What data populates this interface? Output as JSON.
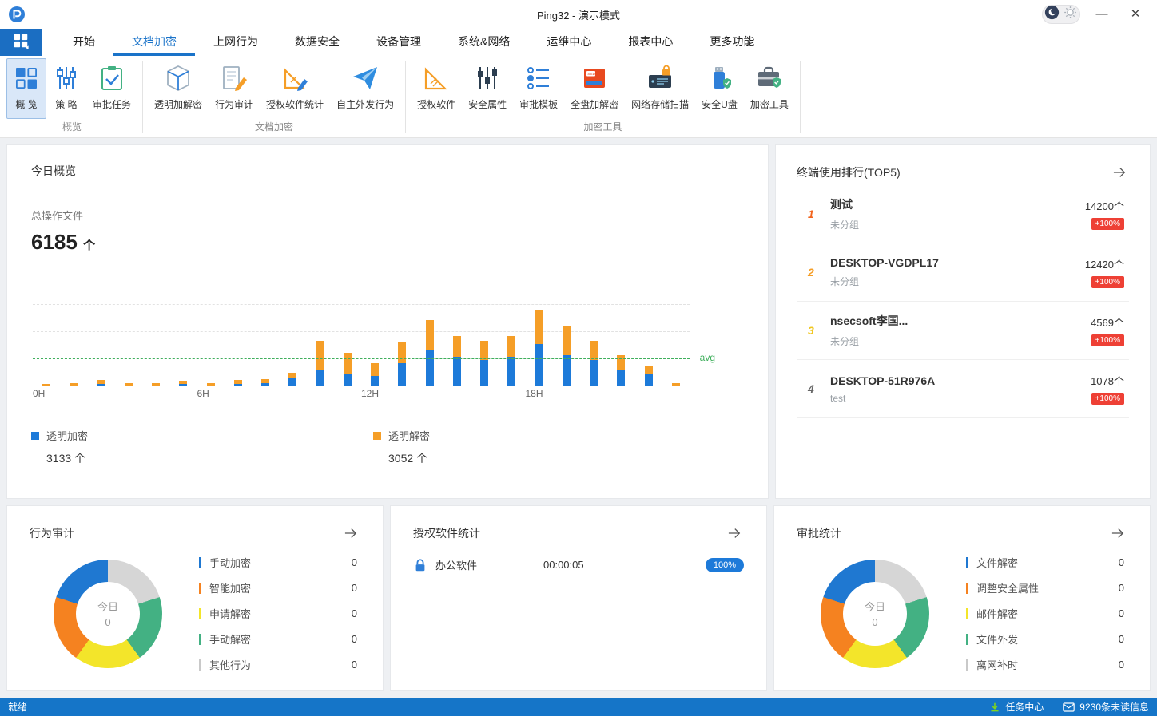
{
  "window": {
    "title": "Ping32 - 演示模式",
    "controls": {
      "minimize": "—",
      "close": "✕"
    }
  },
  "statusbar": {
    "ready": "就绪",
    "task_center": "任务中心",
    "unread": "9230条未读信息"
  },
  "colors": {
    "accent_blue": "#1a73c9",
    "statusbar_blue": "#1575c8",
    "bar_blue": "#1d7ad9",
    "bar_orange": "#f59e27",
    "avg_green": "#3faf5c",
    "badge_red": "#ee4035",
    "badge_blue": "#1d7ad9"
  },
  "ribbon": {
    "tabs": [
      {
        "label": "开始",
        "active": false
      },
      {
        "label": "文档加密",
        "active": true
      },
      {
        "label": "上网行为",
        "active": false
      },
      {
        "label": "数据安全",
        "active": false
      },
      {
        "label": "设备管理",
        "active": false
      },
      {
        "label": "系统&网络",
        "active": false
      },
      {
        "label": "运维中心",
        "active": false
      },
      {
        "label": "报表中心",
        "active": false
      },
      {
        "label": "更多功能",
        "active": false
      }
    ],
    "groups": [
      {
        "label": "概览",
        "items": [
          {
            "label": "概 览",
            "icon": "overview-icon",
            "selected": true
          },
          {
            "label": "策 略",
            "icon": "policy-icon",
            "selected": false
          },
          {
            "label": "审批任务",
            "icon": "approval-task-icon",
            "selected": false
          }
        ]
      },
      {
        "label": "文档加密",
        "items": [
          {
            "label": "透明加解密",
            "icon": "transparent-crypt-icon",
            "selected": false
          },
          {
            "label": "行为审计",
            "icon": "behavior-audit-icon",
            "selected": false
          },
          {
            "label": "授权软件统计",
            "icon": "licensed-stat-icon",
            "selected": false
          },
          {
            "label": "自主外发行为",
            "icon": "outgoing-icon",
            "selected": false
          }
        ]
      },
      {
        "label": "加密工具",
        "items": [
          {
            "label": "授权软件",
            "icon": "licensed-software-icon",
            "selected": false
          },
          {
            "label": "安全属性",
            "icon": "security-attr-icon",
            "selected": false
          },
          {
            "label": "审批模板",
            "icon": "approval-template-icon",
            "selected": false
          },
          {
            "label": "全盘加解密",
            "icon": "full-disk-icon",
            "selected": false
          },
          {
            "label": "网络存储扫描",
            "icon": "network-scan-icon",
            "selected": false
          },
          {
            "label": "安全U盘",
            "icon": "secure-usb-icon",
            "selected": false
          },
          {
            "label": "加密工具",
            "icon": "crypt-tools-icon",
            "selected": false
          }
        ]
      }
    ]
  },
  "cards": {
    "overview": {
      "title": "今日概览",
      "metric_label": "总操作文件",
      "metric_value": "6185",
      "metric_unit": "个"
    },
    "top5": {
      "title": "终端使用排行(TOP5)",
      "items": [
        {
          "rank": "1",
          "rank_color": "#f2641d",
          "name": "测试",
          "group": "未分组",
          "count": "14200个",
          "change": "+100%"
        },
        {
          "rank": "2",
          "rank_color": "#f59e27",
          "name": "DESKTOP-VGDPL17",
          "group": "未分组",
          "count": "12420个",
          "change": "+100%"
        },
        {
          "rank": "3",
          "rank_color": "#f0c61f",
          "name": "nsecsoft李国...",
          "group": "未分组",
          "count": "4569个",
          "change": "+100%"
        },
        {
          "rank": "4",
          "rank_color": "#666666",
          "name": "DESKTOP-51R976A",
          "group": "test",
          "count": "1078个",
          "change": "+100%"
        }
      ]
    },
    "behavior": {
      "title": "行为审计"
    },
    "software": {
      "title": "授权软件统计",
      "rows": [
        {
          "name": "办公软件",
          "duration": "00:00:05",
          "percent": "100%"
        }
      ]
    },
    "approval": {
      "title": "审批统计"
    }
  },
  "chart_data": [
    {
      "type": "bar",
      "stacked": true,
      "title": "今日概览",
      "xlabel": "",
      "ylabel": "",
      "x": [
        "0H",
        "1H",
        "2H",
        "3H",
        "4H",
        "5H",
        "6H",
        "7H",
        "8H",
        "9H",
        "10H",
        "11H",
        "12H",
        "13H",
        "14H",
        "15H",
        "16H",
        "17H",
        "18H",
        "19H",
        "20H",
        "21H",
        "22H",
        "23H"
      ],
      "x_tick_interval": 6,
      "grid": "dashed-horizontal",
      "avg_line": true,
      "avg_label": "avg",
      "avg_value": 258,
      "series": [
        {
          "name": "透明加密",
          "color": "#1d7ad9",
          "total": "3133 个",
          "values": [
            0,
            0,
            20,
            0,
            0,
            20,
            0,
            20,
            30,
            80,
            150,
            120,
            100,
            220,
            350,
            280,
            250,
            280,
            400,
            300,
            250,
            150,
            113,
            0
          ]
        },
        {
          "name": "透明解密",
          "color": "#f59e27",
          "total": "3052 个",
          "values": [
            20,
            30,
            40,
            30,
            30,
            30,
            30,
            40,
            40,
            50,
            280,
            200,
            120,
            200,
            280,
            200,
            180,
            200,
            330,
            280,
            180,
            150,
            80,
            32
          ]
        }
      ]
    },
    {
      "type": "pie",
      "title": "行为审计",
      "center_label": "今日",
      "center_value": "0",
      "labels": [
        "手动加密",
        "智能加密",
        "申请解密",
        "手动解密",
        "其他行为"
      ],
      "values": [
        0,
        0,
        0,
        0,
        0
      ],
      "colors": [
        "#1f78d1",
        "#f58220",
        "#f3e52a",
        "#43b183",
        "#c9c9c9"
      ],
      "ring_colors": [
        "#d6d6d6",
        "#43b183",
        "#f3e52a",
        "#f58220",
        "#1f78d1"
      ]
    },
    {
      "type": "pie",
      "title": "审批统计",
      "center_label": "今日",
      "center_value": "0",
      "labels": [
        "文件解密",
        "调整安全属性",
        "邮件解密",
        "文件外发",
        "离网补时"
      ],
      "values": [
        0,
        0,
        0,
        0,
        0
      ],
      "colors": [
        "#1f78d1",
        "#f58220",
        "#f3e52a",
        "#43b183",
        "#c9c9c9"
      ],
      "ring_colors": [
        "#d6d6d6",
        "#43b183",
        "#f3e52a",
        "#f58220",
        "#1f78d1"
      ]
    }
  ]
}
